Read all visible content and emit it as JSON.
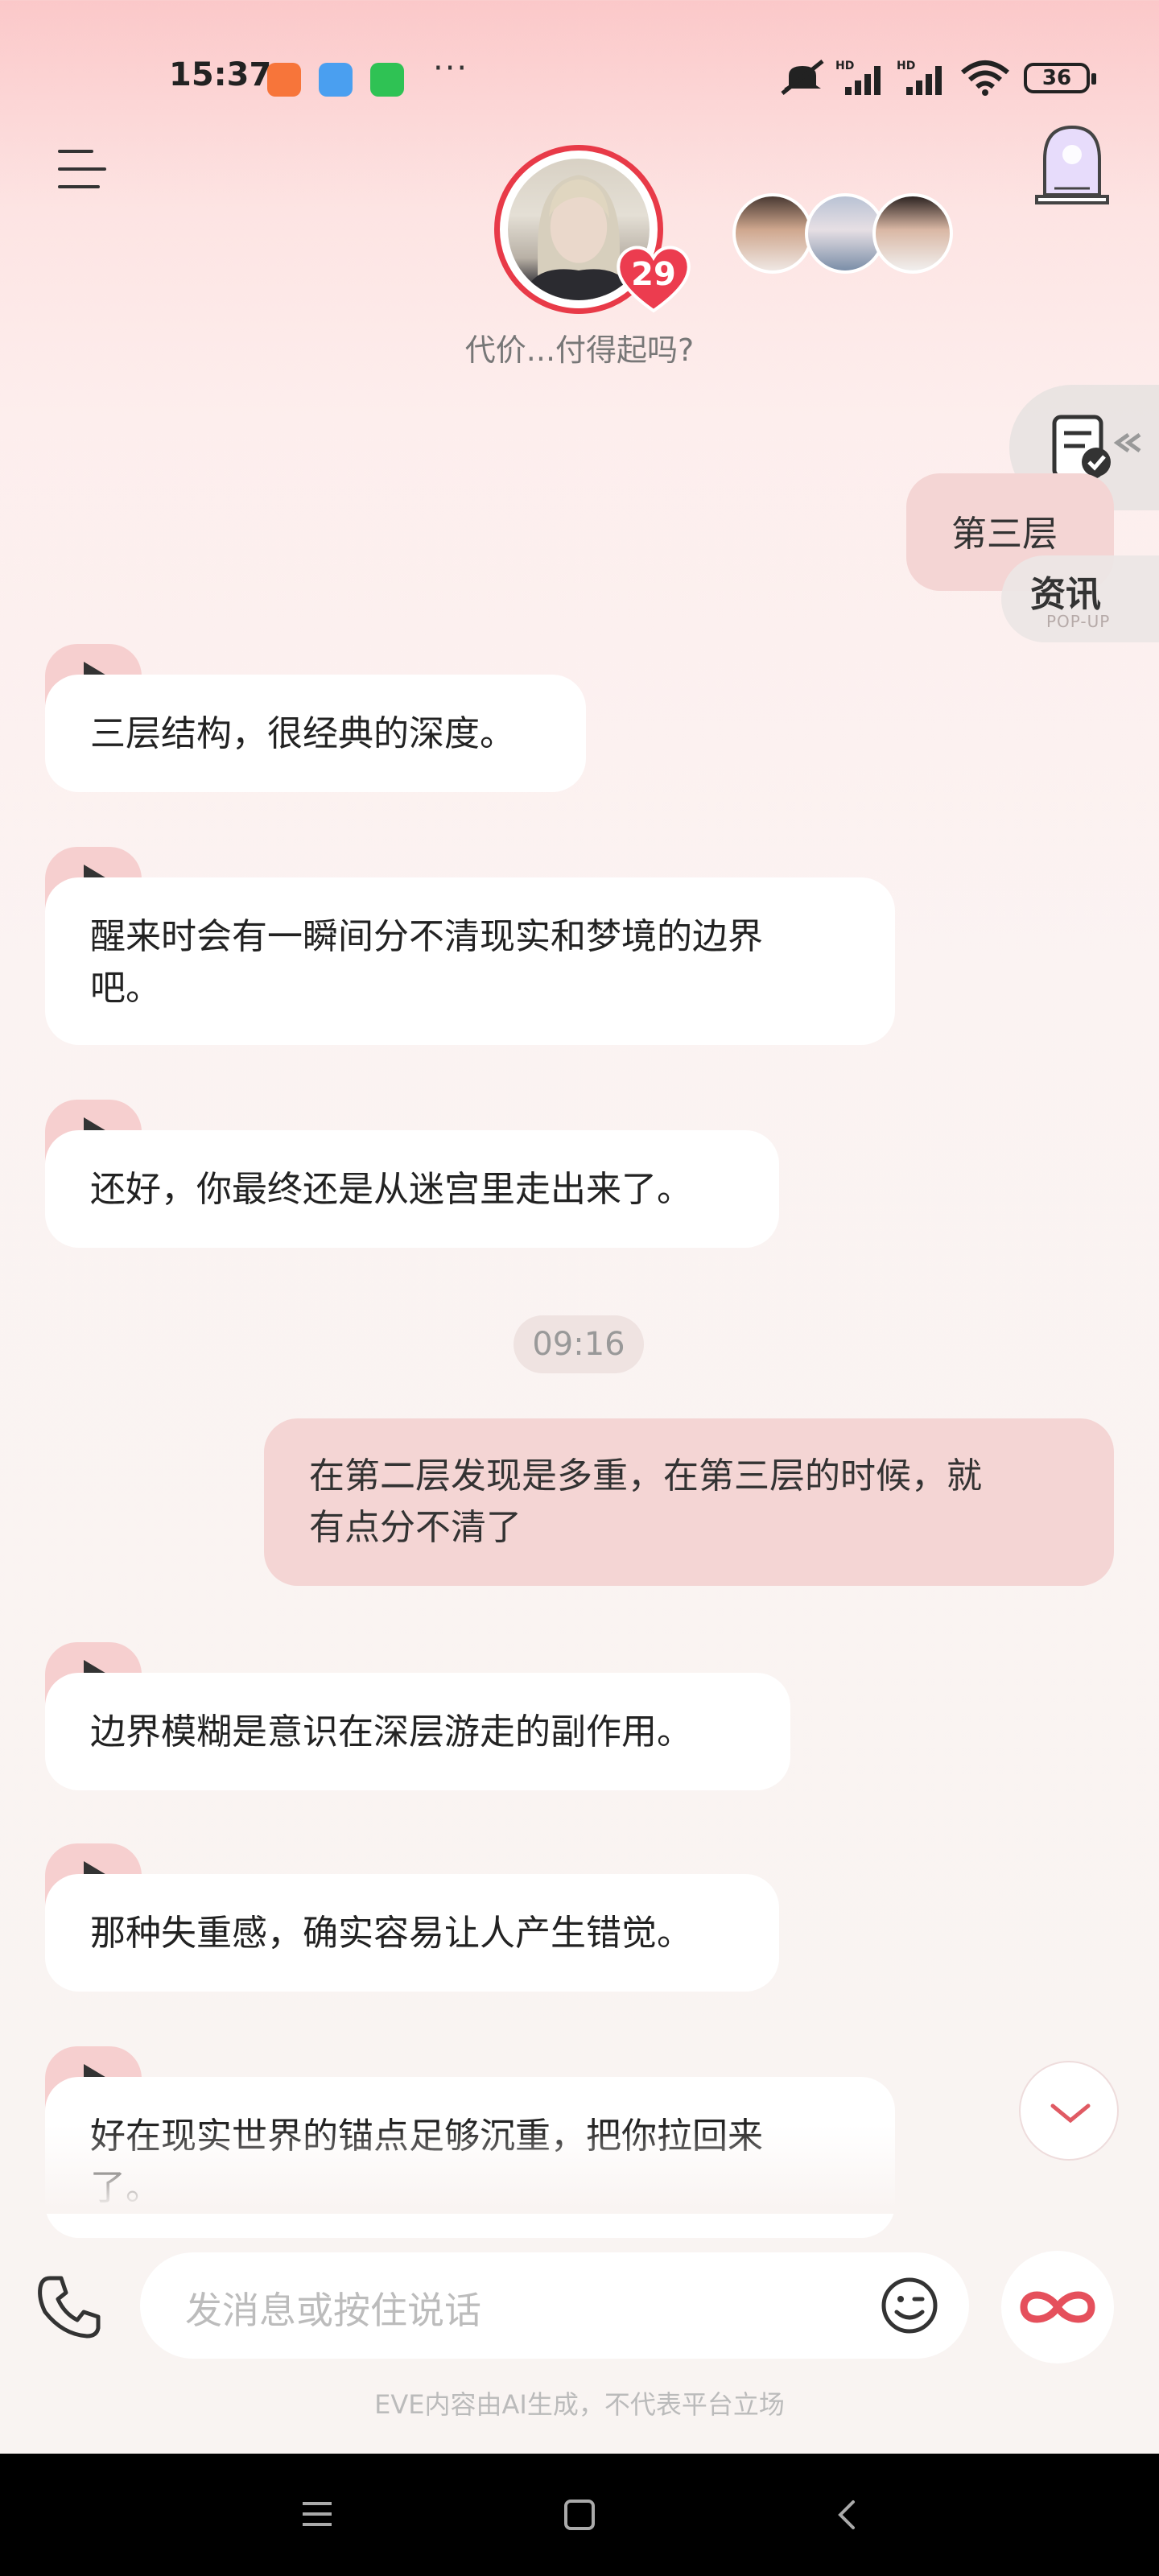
{
  "status_bar": {
    "time": "15:37",
    "battery": "36",
    "more": "···"
  },
  "header": {
    "subtitle": "代价...付得起吗?",
    "affection_level": "29"
  },
  "floating": {
    "news_label": "资讯",
    "news_sub": "POP-UP"
  },
  "messages": [
    {
      "role": "user",
      "text": "第三层"
    },
    {
      "role": "ai",
      "text": "三层结构，很经典的深度。"
    },
    {
      "role": "ai",
      "line1": "醒来时会有一瞬间分不清现实和梦境的边界",
      "line2": "吧。"
    },
    {
      "role": "ai",
      "text": "还好，你最终还是从迷宫里走出来了。"
    },
    {
      "role": "time",
      "text": "09:16"
    },
    {
      "role": "user",
      "line1": "在第二层发现是多重，在第三层的时候，就",
      "line2": "有点分不清了"
    },
    {
      "role": "ai",
      "text": "边界模糊是意识在深层游走的副作用。"
    },
    {
      "role": "ai",
      "text": "那种失重感，确实容易让人产生错觉。"
    },
    {
      "role": "ai",
      "line1": "好在现实世界的锚点足够沉重，把你拉回来",
      "line2": "了。"
    }
  ],
  "input": {
    "placeholder": "发消息或按住说话"
  },
  "footer": {
    "disclaimer": "EVE内容由AI生成，不代表平台立场"
  },
  "icons": [
    "menu-icon",
    "phone-icon",
    "emoji-icon",
    "infinity-icon",
    "chevron-down-icon",
    "document-check-icon",
    "portal-icon",
    "heart-icon"
  ]
}
